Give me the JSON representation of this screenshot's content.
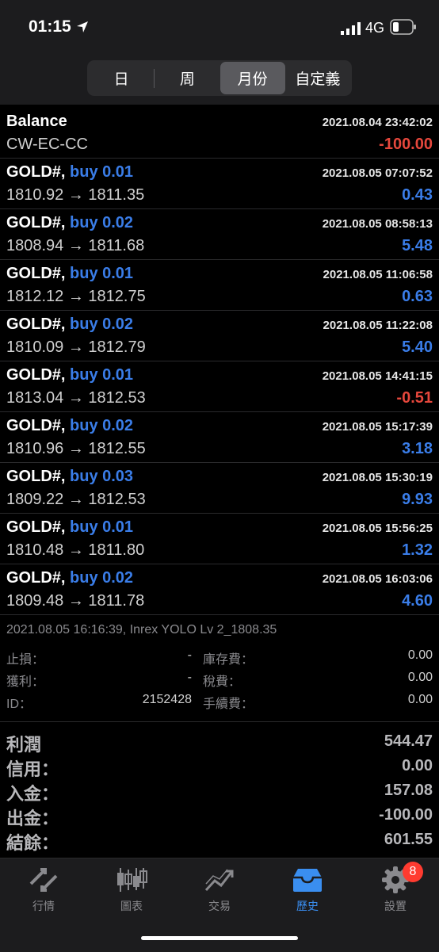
{
  "status_bar": {
    "time": "01:15",
    "network": "4G"
  },
  "period_tabs": [
    {
      "label": "日",
      "active": false
    },
    {
      "label": "周",
      "active": false
    },
    {
      "label": "月份",
      "active": true
    },
    {
      "label": "自定義",
      "active": false
    }
  ],
  "balance_row": {
    "title": "Balance",
    "comment": "CW-EC-CC",
    "time": "2021.08.04 23:42:02",
    "amount": "-100.00"
  },
  "trades": [
    {
      "symbol": "GOLD#,",
      "side": "buy 0.01",
      "time": "2021.08.05 07:07:52",
      "prices": "1810.92 → 1811.35",
      "profit": "0.43",
      "negative": false
    },
    {
      "symbol": "GOLD#,",
      "side": "buy 0.02",
      "time": "2021.08.05 08:58:13",
      "prices": "1808.94 → 1811.68",
      "profit": "5.48",
      "negative": false
    },
    {
      "symbol": "GOLD#,",
      "side": "buy 0.01",
      "time": "2021.08.05 11:06:58",
      "prices": "1812.12 → 1812.75",
      "profit": "0.63",
      "negative": false
    },
    {
      "symbol": "GOLD#,",
      "side": "buy 0.02",
      "time": "2021.08.05 11:22:08",
      "prices": "1810.09 → 1812.79",
      "profit": "5.40",
      "negative": false
    },
    {
      "symbol": "GOLD#,",
      "side": "buy 0.01",
      "time": "2021.08.05 14:41:15",
      "prices": "1813.04 → 1812.53",
      "profit": "-0.51",
      "negative": true
    },
    {
      "symbol": "GOLD#,",
      "side": "buy 0.02",
      "time": "2021.08.05 15:17:39",
      "prices": "1810.96 → 1812.55",
      "profit": "3.18",
      "negative": false
    },
    {
      "symbol": "GOLD#,",
      "side": "buy 0.03",
      "time": "2021.08.05 15:30:19",
      "prices": "1809.22 → 1812.53",
      "profit": "9.93",
      "negative": false
    },
    {
      "symbol": "GOLD#,",
      "side": "buy 0.01",
      "time": "2021.08.05 15:56:25",
      "prices": "1810.48 → 1811.80",
      "profit": "1.32",
      "negative": false
    },
    {
      "symbol": "GOLD#,",
      "side": "buy 0.02",
      "time": "2021.08.05 16:03:06",
      "prices": "1809.48 → 1811.78",
      "profit": "4.60",
      "negative": false
    }
  ],
  "detail": {
    "header": "2021.08.05 16:16:39, Inrex YOLO Lv 2_1808.35",
    "stop_loss_label": "止損：",
    "stop_loss_value": "-",
    "take_profit_label": "獲利：",
    "take_profit_value": "-",
    "id_label": "ID：",
    "id_value": "2152428",
    "swap_label": "庫存費：",
    "swap_value": "0.00",
    "tax_label": "稅費：",
    "tax_value": "0.00",
    "commission_label": "手續費：",
    "commission_value": "0.00"
  },
  "summary": [
    {
      "label": "利潤",
      "value": "544.47"
    },
    {
      "label": "信用：",
      "value": "0.00"
    },
    {
      "label": "入金：",
      "value": "157.08"
    },
    {
      "label": "出金：",
      "value": "-100.00"
    },
    {
      "label": "結餘：",
      "value": "601.55"
    }
  ],
  "tabbar": [
    {
      "label": "行情",
      "icon": "quotes-icon",
      "active": false
    },
    {
      "label": "圖表",
      "icon": "chart-icon",
      "active": false
    },
    {
      "label": "交易",
      "icon": "trade-icon",
      "active": false
    },
    {
      "label": "歷史",
      "icon": "history-icon",
      "active": true
    },
    {
      "label": "設置",
      "icon": "settings-icon",
      "active": false
    }
  ],
  "settings_badge": "8",
  "colors": {
    "accent": "#3a7de8",
    "negative": "#e5473c",
    "tab_active": "#3a8ef0",
    "badge": "#ff3b30"
  }
}
